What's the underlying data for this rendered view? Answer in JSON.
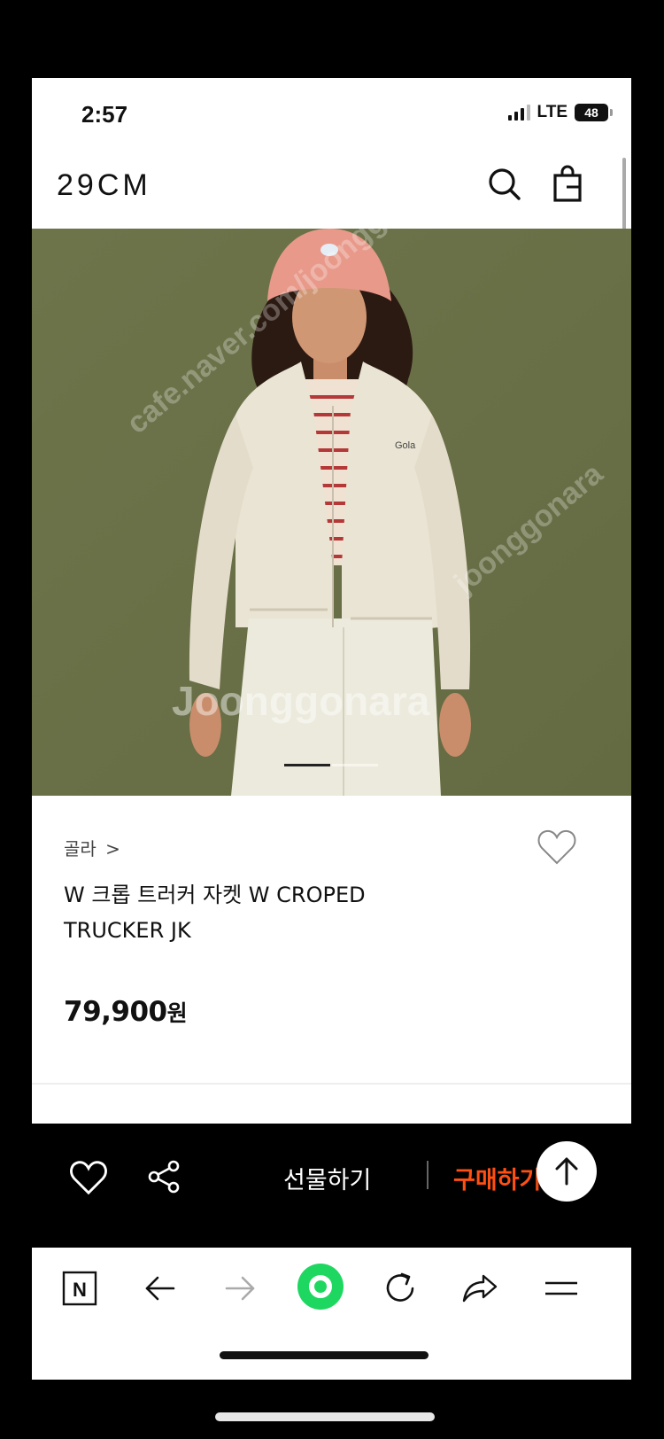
{
  "status_bar": {
    "time": "2:57",
    "network": "LTE",
    "battery": "48"
  },
  "header": {
    "logo": "29CM",
    "search_icon": "search-icon",
    "cart_icon": "shopping-bag-icon"
  },
  "hero": {
    "image_description_icon": "product-photo",
    "watermarks": [
      "cafe.naver.com/joonggonara",
      "Joonggonara",
      "joonggonara"
    ],
    "pager": {
      "total": 2,
      "active": 1
    },
    "logo_on_jacket": "Gola"
  },
  "product": {
    "brand": "골라",
    "brand_chevron": ">",
    "title": "W 크롭 트러커 자켓 W CROPED TRUCKER JK",
    "price": "79,900",
    "currency": "원"
  },
  "action_bar": {
    "gift": "선물하기",
    "buy": "구매하기",
    "like_icon": "heart-icon",
    "share_icon": "share-icon",
    "top_icon": "arrow-up-icon"
  },
  "browser_toolbar": {
    "icons": [
      "naver-n-icon",
      "back-arrow-icon",
      "forward-arrow-icon",
      "green-dot-home-icon",
      "reload-icon",
      "share-arrow-icon",
      "menu-icon"
    ]
  },
  "colors": {
    "accent_buy": "#ff4f12",
    "green_button": "#1ed760",
    "hero_bg": "#6c7249"
  }
}
